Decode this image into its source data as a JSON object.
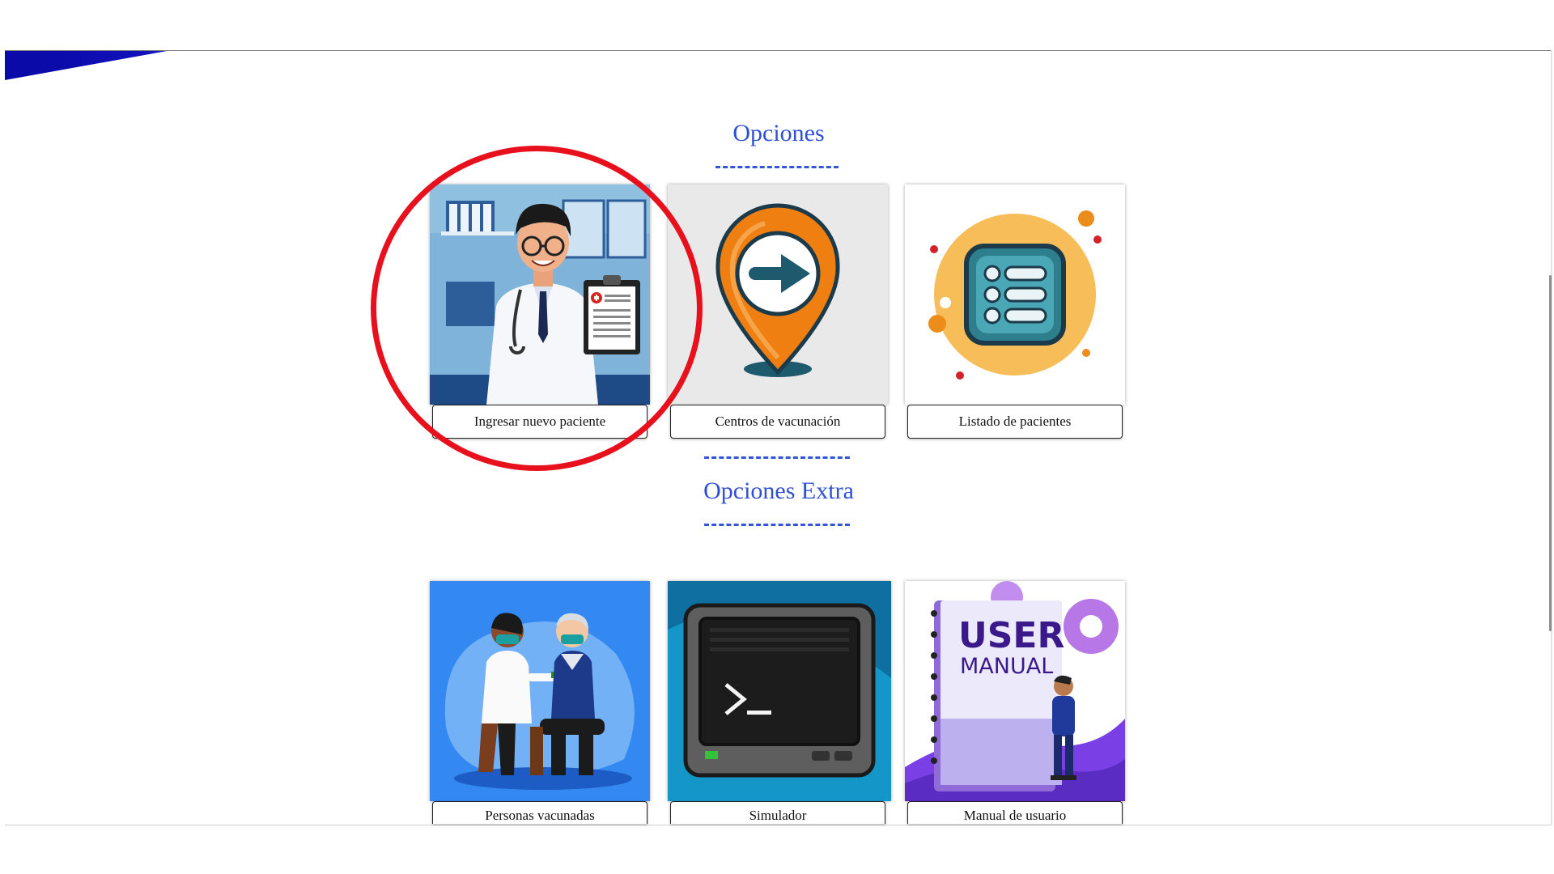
{
  "main": {
    "options_title": "Opciones",
    "extra_title": "Opciones Extra",
    "options": [
      {
        "label": "Ingresar nuevo paciente",
        "icon": "doctor-icon"
      },
      {
        "label": "Centros de vacunación",
        "icon": "location-pin-arrow-icon"
      },
      {
        "label": "Listado de pacientes",
        "icon": "list-icon"
      }
    ],
    "extra_options": [
      {
        "label": "Personas vacunadas",
        "icon": "vaccination-icon"
      },
      {
        "label": "Simulador",
        "icon": "terminal-icon"
      },
      {
        "label": "Manual de usuario",
        "icon": "user-manual-icon",
        "image_text_1": "USER",
        "image_text_2": "MANUAL"
      }
    ]
  },
  "colors": {
    "accent": "#2f4fd6",
    "highlight": "#e8101c",
    "logo": "#0a0aa8"
  }
}
